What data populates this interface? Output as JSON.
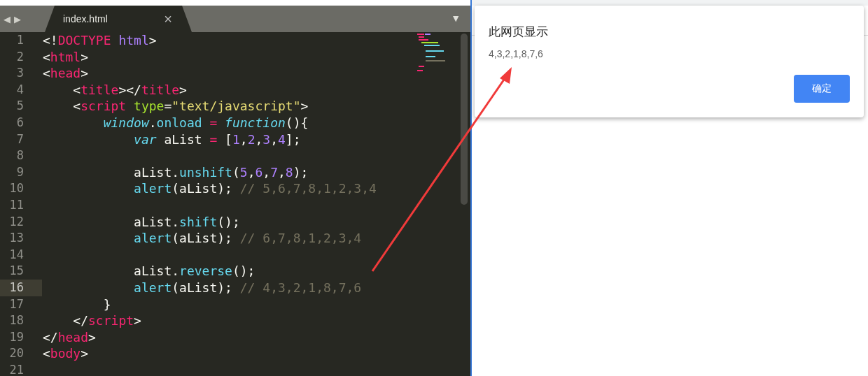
{
  "editor": {
    "nav": {
      "back": "◀",
      "forward": "▶"
    },
    "tabs": [
      {
        "label": "index.html",
        "close": "×",
        "selected": true
      }
    ],
    "menu": "▼",
    "lines": [
      {
        "number": "1",
        "current": false,
        "tokens": [
          {
            "kind": "plain",
            "text": "<!"
          },
          {
            "kind": "tag",
            "text": "DOCTYPE "
          },
          {
            "kind": "number",
            "text": "html"
          },
          {
            "kind": "plain",
            "text": ">"
          }
        ]
      },
      {
        "number": "2",
        "current": false,
        "tokens": [
          {
            "kind": "plain",
            "text": "<"
          },
          {
            "kind": "tag",
            "text": "html"
          },
          {
            "kind": "plain",
            "text": ">"
          }
        ]
      },
      {
        "number": "3",
        "current": false,
        "tokens": [
          {
            "kind": "plain",
            "text": "<"
          },
          {
            "kind": "tag",
            "text": "head"
          },
          {
            "kind": "plain",
            "text": ">"
          }
        ]
      },
      {
        "number": "4",
        "current": false,
        "tokens": [
          {
            "kind": "plain",
            "text": "    <"
          },
          {
            "kind": "tag",
            "text": "title"
          },
          {
            "kind": "plain",
            "text": "></"
          },
          {
            "kind": "tag",
            "text": "title"
          },
          {
            "kind": "plain",
            "text": ">"
          }
        ]
      },
      {
        "number": "5",
        "current": false,
        "tokens": [
          {
            "kind": "plain",
            "text": "    <"
          },
          {
            "kind": "tag",
            "text": "script "
          },
          {
            "kind": "attr",
            "text": "type"
          },
          {
            "kind": "plain",
            "text": "="
          },
          {
            "kind": "string",
            "text": "\"text/javascript\""
          },
          {
            "kind": "plain",
            "text": ">"
          }
        ]
      },
      {
        "number": "6",
        "current": false,
        "tokens": [
          {
            "kind": "keyword",
            "text": "        window"
          },
          {
            "kind": "plain",
            "text": "."
          },
          {
            "kind": "func",
            "text": "onload "
          },
          {
            "kind": "tag",
            "text": "= "
          },
          {
            "kind": "keyword",
            "text": "function"
          },
          {
            "kind": "plain",
            "text": "(){"
          }
        ]
      },
      {
        "number": "7",
        "current": false,
        "tokens": [
          {
            "kind": "keyword",
            "text": "            var"
          },
          {
            "kind": "plain",
            "text": " aList "
          },
          {
            "kind": "tag",
            "text": "="
          },
          {
            "kind": "plain",
            "text": " ["
          },
          {
            "kind": "number",
            "text": "1"
          },
          {
            "kind": "plain",
            "text": ","
          },
          {
            "kind": "number",
            "text": "2"
          },
          {
            "kind": "plain",
            "text": ","
          },
          {
            "kind": "number",
            "text": "3"
          },
          {
            "kind": "plain",
            "text": ","
          },
          {
            "kind": "number",
            "text": "4"
          },
          {
            "kind": "plain",
            "text": "];"
          }
        ]
      },
      {
        "number": "8",
        "current": false
      },
      {
        "number": "9",
        "current": false,
        "tokens": [
          {
            "kind": "plain",
            "text": "            aList."
          },
          {
            "kind": "func",
            "text": "unshift"
          },
          {
            "kind": "plain",
            "text": "("
          },
          {
            "kind": "number",
            "text": "5"
          },
          {
            "kind": "plain",
            "text": ","
          },
          {
            "kind": "number",
            "text": "6"
          },
          {
            "kind": "plain",
            "text": ","
          },
          {
            "kind": "number",
            "text": "7"
          },
          {
            "kind": "plain",
            "text": ","
          },
          {
            "kind": "number",
            "text": "8"
          },
          {
            "kind": "plain",
            "text": ");"
          }
        ]
      },
      {
        "number": "10",
        "current": false,
        "tokens": [
          {
            "kind": "func",
            "text": "            alert"
          },
          {
            "kind": "plain",
            "text": "(aList); "
          },
          {
            "kind": "comment",
            "text": "// 5,6,7,8,1,2,3,4"
          }
        ]
      },
      {
        "number": "11",
        "current": false
      },
      {
        "number": "12",
        "current": false,
        "tokens": [
          {
            "kind": "plain",
            "text": "            aList."
          },
          {
            "kind": "func",
            "text": "shift"
          },
          {
            "kind": "plain",
            "text": "();"
          }
        ]
      },
      {
        "number": "13",
        "current": false,
        "tokens": [
          {
            "kind": "func",
            "text": "            alert"
          },
          {
            "kind": "plain",
            "text": "(aList); "
          },
          {
            "kind": "comment",
            "text": "// 6,7,8,1,2,3,4"
          }
        ]
      },
      {
        "number": "14",
        "current": false
      },
      {
        "number": "15",
        "current": false,
        "tokens": [
          {
            "kind": "plain",
            "text": "            aList."
          },
          {
            "kind": "func",
            "text": "reverse"
          },
          {
            "kind": "plain",
            "text": "();"
          }
        ]
      },
      {
        "number": "16",
        "current": true,
        "tokens": [
          {
            "kind": "func",
            "text": "            alert"
          },
          {
            "kind": "plain",
            "text": "(aList); "
          },
          {
            "kind": "comment",
            "text": "// 4,3,2,1,8,7,6"
          }
        ]
      },
      {
        "number": "17",
        "current": false,
        "tokens": [
          {
            "kind": "plain",
            "text": "        }"
          }
        ]
      },
      {
        "number": "18",
        "current": false,
        "tokens": [
          {
            "kind": "plain",
            "text": "    </"
          },
          {
            "kind": "tag",
            "text": "script"
          },
          {
            "kind": "plain",
            "text": ">"
          }
        ]
      },
      {
        "number": "19",
        "current": false,
        "tokens": [
          {
            "kind": "plain",
            "text": "</"
          },
          {
            "kind": "tag",
            "text": "head"
          },
          {
            "kind": "plain",
            "text": ">"
          }
        ]
      },
      {
        "number": "20",
        "current": false,
        "tokens": [
          {
            "kind": "plain",
            "text": "<"
          },
          {
            "kind": "tag",
            "text": "body"
          },
          {
            "kind": "plain",
            "text": ">"
          }
        ]
      },
      {
        "number": "21",
        "current": false
      }
    ]
  },
  "dialog": {
    "title": "此网页显示",
    "message": "4,3,2,1,8,7,6",
    "button": "确定"
  }
}
